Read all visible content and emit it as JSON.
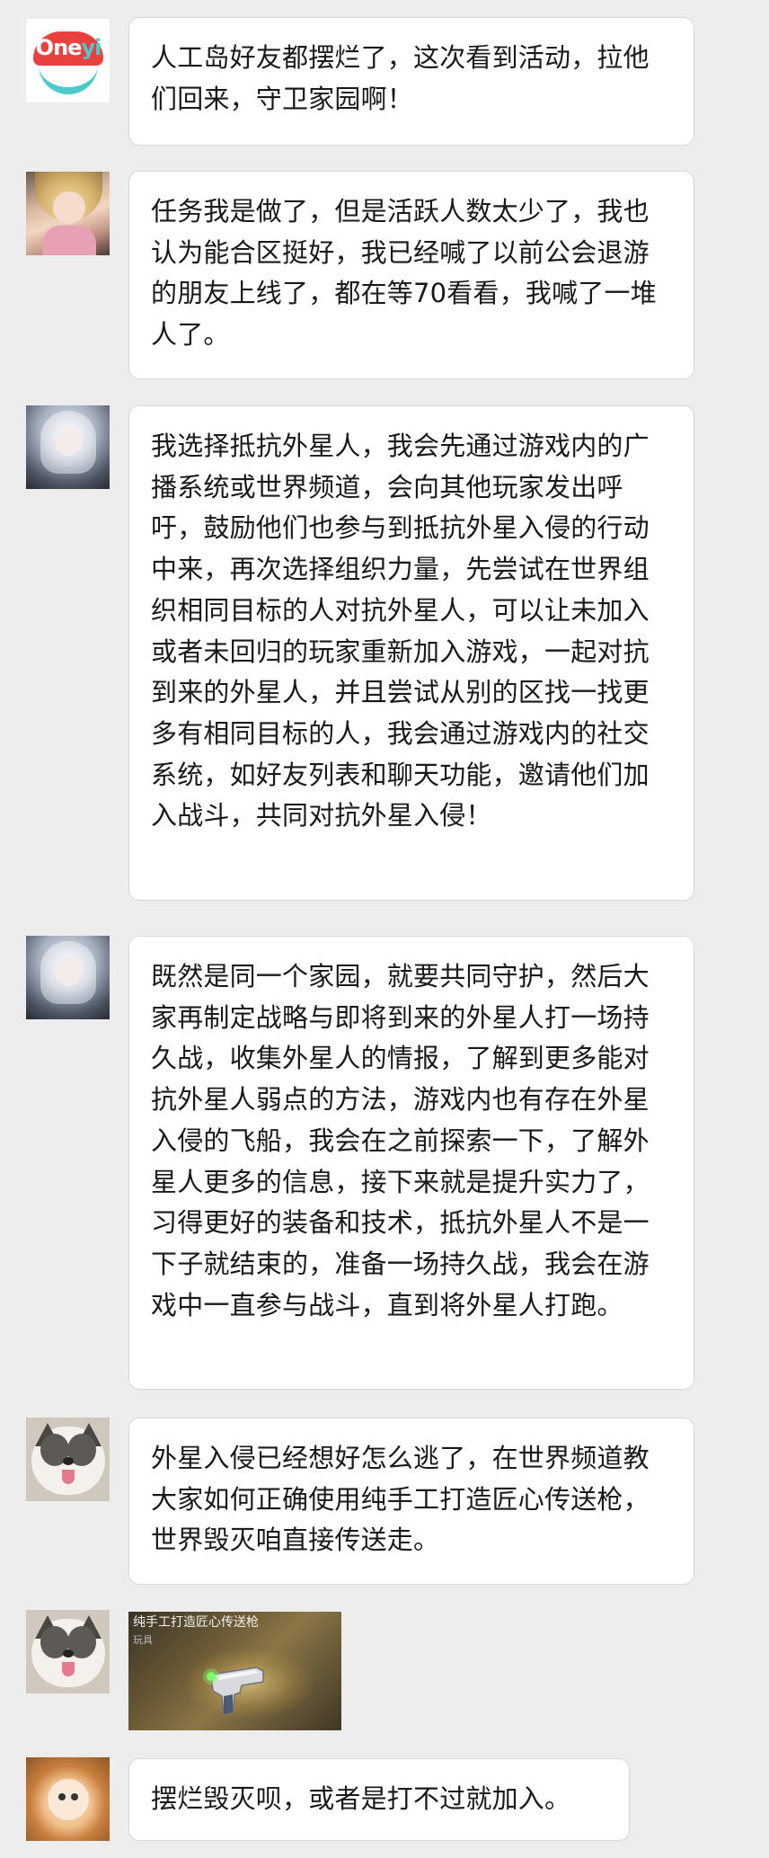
{
  "messages": [
    {
      "avatar": "oneyi-logo-avatar",
      "logo_text": "One",
      "logo_text_yi": "yi",
      "text": "人工岛好友都摆烂了，这次看到活动，拉他们回来，守卫家园啊！"
    },
    {
      "avatar": "anime-girl-avatar",
      "text": "任务我是做了，但是活跃人数太少了，我也认为能合区挺好，我已经喊了以前公会退游的朋友上线了，都在等70看看，我喊了一堆人了。"
    },
    {
      "avatar": "silver-hair-avatar",
      "text": "我选择抵抗外星人，我会先通过游戏内的广播系统或世界频道，会向其他玩家发出呼吁，鼓励他们也参与到抵抗外星入侵的行动中来，再次选择组织力量，先尝试在世界组织相同目标的人对抗外星人，可以让未加入或者未回归的玩家重新加入游戏，一起对抗到来的外星人，并且尝试从别的区找一找更多有相同目标的人，我会通过游戏内的社交系统，如好友列表和聊天功能，邀请他们加入战斗，共同对抗外星入侵！"
    },
    {
      "avatar": "silver-hair-avatar",
      "text": "既然是同一个家园，就要共同守护，然后大家再制定战略与即将到来的外星人打一场持久战，收集外星人的情报，了解到更多能对抗外星人弱点的方法，游戏内也有存在外星入侵的飞船，我会在之前探索一下，了解外星人更多的信息，接下来就是提升实力了，习得更好的装备和技术，抵抗外星人不是一下子就结束的，准备一场持久战，我会在游戏中一直参与战斗，直到将外星人打跑。"
    },
    {
      "avatar": "husky-avatar",
      "text": "外星入侵已经想好怎么逃了，在世界频道教大家如何正确使用纯手工打造匠心传送枪，世界毁灭咱直接传送走。"
    },
    {
      "avatar": "husky-avatar",
      "image": {
        "caption": "纯手工打造匠心传送枪",
        "tag": "玩具"
      }
    },
    {
      "avatar": "cat-avatar",
      "text": "摆烂毁灭呗，或者是打不过就加入。"
    }
  ]
}
